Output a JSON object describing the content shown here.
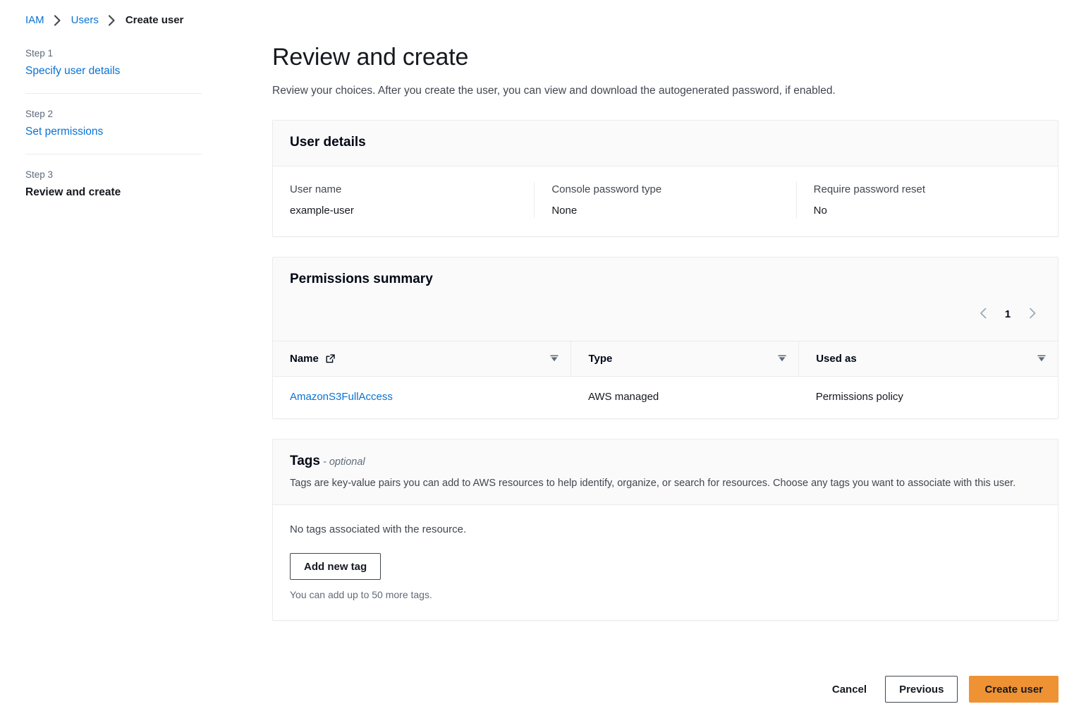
{
  "breadcrumb": {
    "items": [
      {
        "label": "IAM",
        "current": false
      },
      {
        "label": "Users",
        "current": false
      },
      {
        "label": "Create user",
        "current": true
      }
    ]
  },
  "wizard": {
    "steps": [
      {
        "step_label": "Step 1",
        "title": "Specify user details",
        "active": false
      },
      {
        "step_label": "Step 2",
        "title": "Set permissions",
        "active": false
      },
      {
        "step_label": "Step 3",
        "title": "Review and create",
        "active": true
      }
    ]
  },
  "page": {
    "title": "Review and create",
    "description": "Review your choices. After you create the user, you can view and download the autogenerated password, if enabled."
  },
  "user_details": {
    "title": "User details",
    "fields": [
      {
        "key": "User name",
        "value": "example-user"
      },
      {
        "key": "Console password type",
        "value": "None"
      },
      {
        "key": "Require password reset",
        "value": "No"
      }
    ]
  },
  "permissions_summary": {
    "title": "Permissions summary",
    "pagination": {
      "previous_icon": "chevron-left-icon",
      "page_number": "1",
      "next_icon": "chevron-right-icon"
    },
    "columns": [
      {
        "label": "Name",
        "icon": "external-link-icon",
        "sort_icon": "sort-icon"
      },
      {
        "label": "Type",
        "icon": null,
        "sort_icon": "sort-icon"
      },
      {
        "label": "Used as",
        "icon": null,
        "sort_icon": "sort-icon"
      }
    ],
    "rows": [
      {
        "name": "AmazonS3FullAccess",
        "type": "AWS managed",
        "used_as": "Permissions policy"
      }
    ]
  },
  "tags": {
    "title": "Tags",
    "optional_suffix": " - optional",
    "description": "Tags are key-value pairs you can add to AWS resources to help identify, organize, or search for resources. Choose any tags you want to associate with this user.",
    "empty_text": "No tags associated with the resource.",
    "add_button_label": "Add new tag",
    "hint": "You can add up to 50 more tags."
  },
  "footer": {
    "cancel_label": "Cancel",
    "previous_label": "Previous",
    "create_label": "Create user"
  },
  "colors": {
    "link": "#0972d3",
    "primary_button": "#ef9234",
    "text": "#16191f",
    "muted_text": "#5f6b7a",
    "border": "#e9ebed",
    "header_bg": "#fafafa"
  }
}
